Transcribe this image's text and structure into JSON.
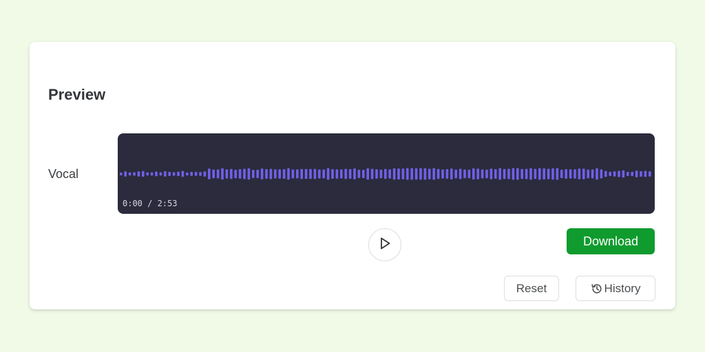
{
  "preview": {
    "title": "Preview",
    "track_label": "Vocal",
    "time_display": "0:00 / 2:53",
    "waveform_color": "#7160e8",
    "panel_color": "#2b2b3d"
  },
  "actions": {
    "play_icon": "play-icon",
    "download_label": "Download",
    "download_color": "#0f9b2e",
    "reset_label": "Reset",
    "history_icon": "history-icon",
    "history_label": "History"
  }
}
